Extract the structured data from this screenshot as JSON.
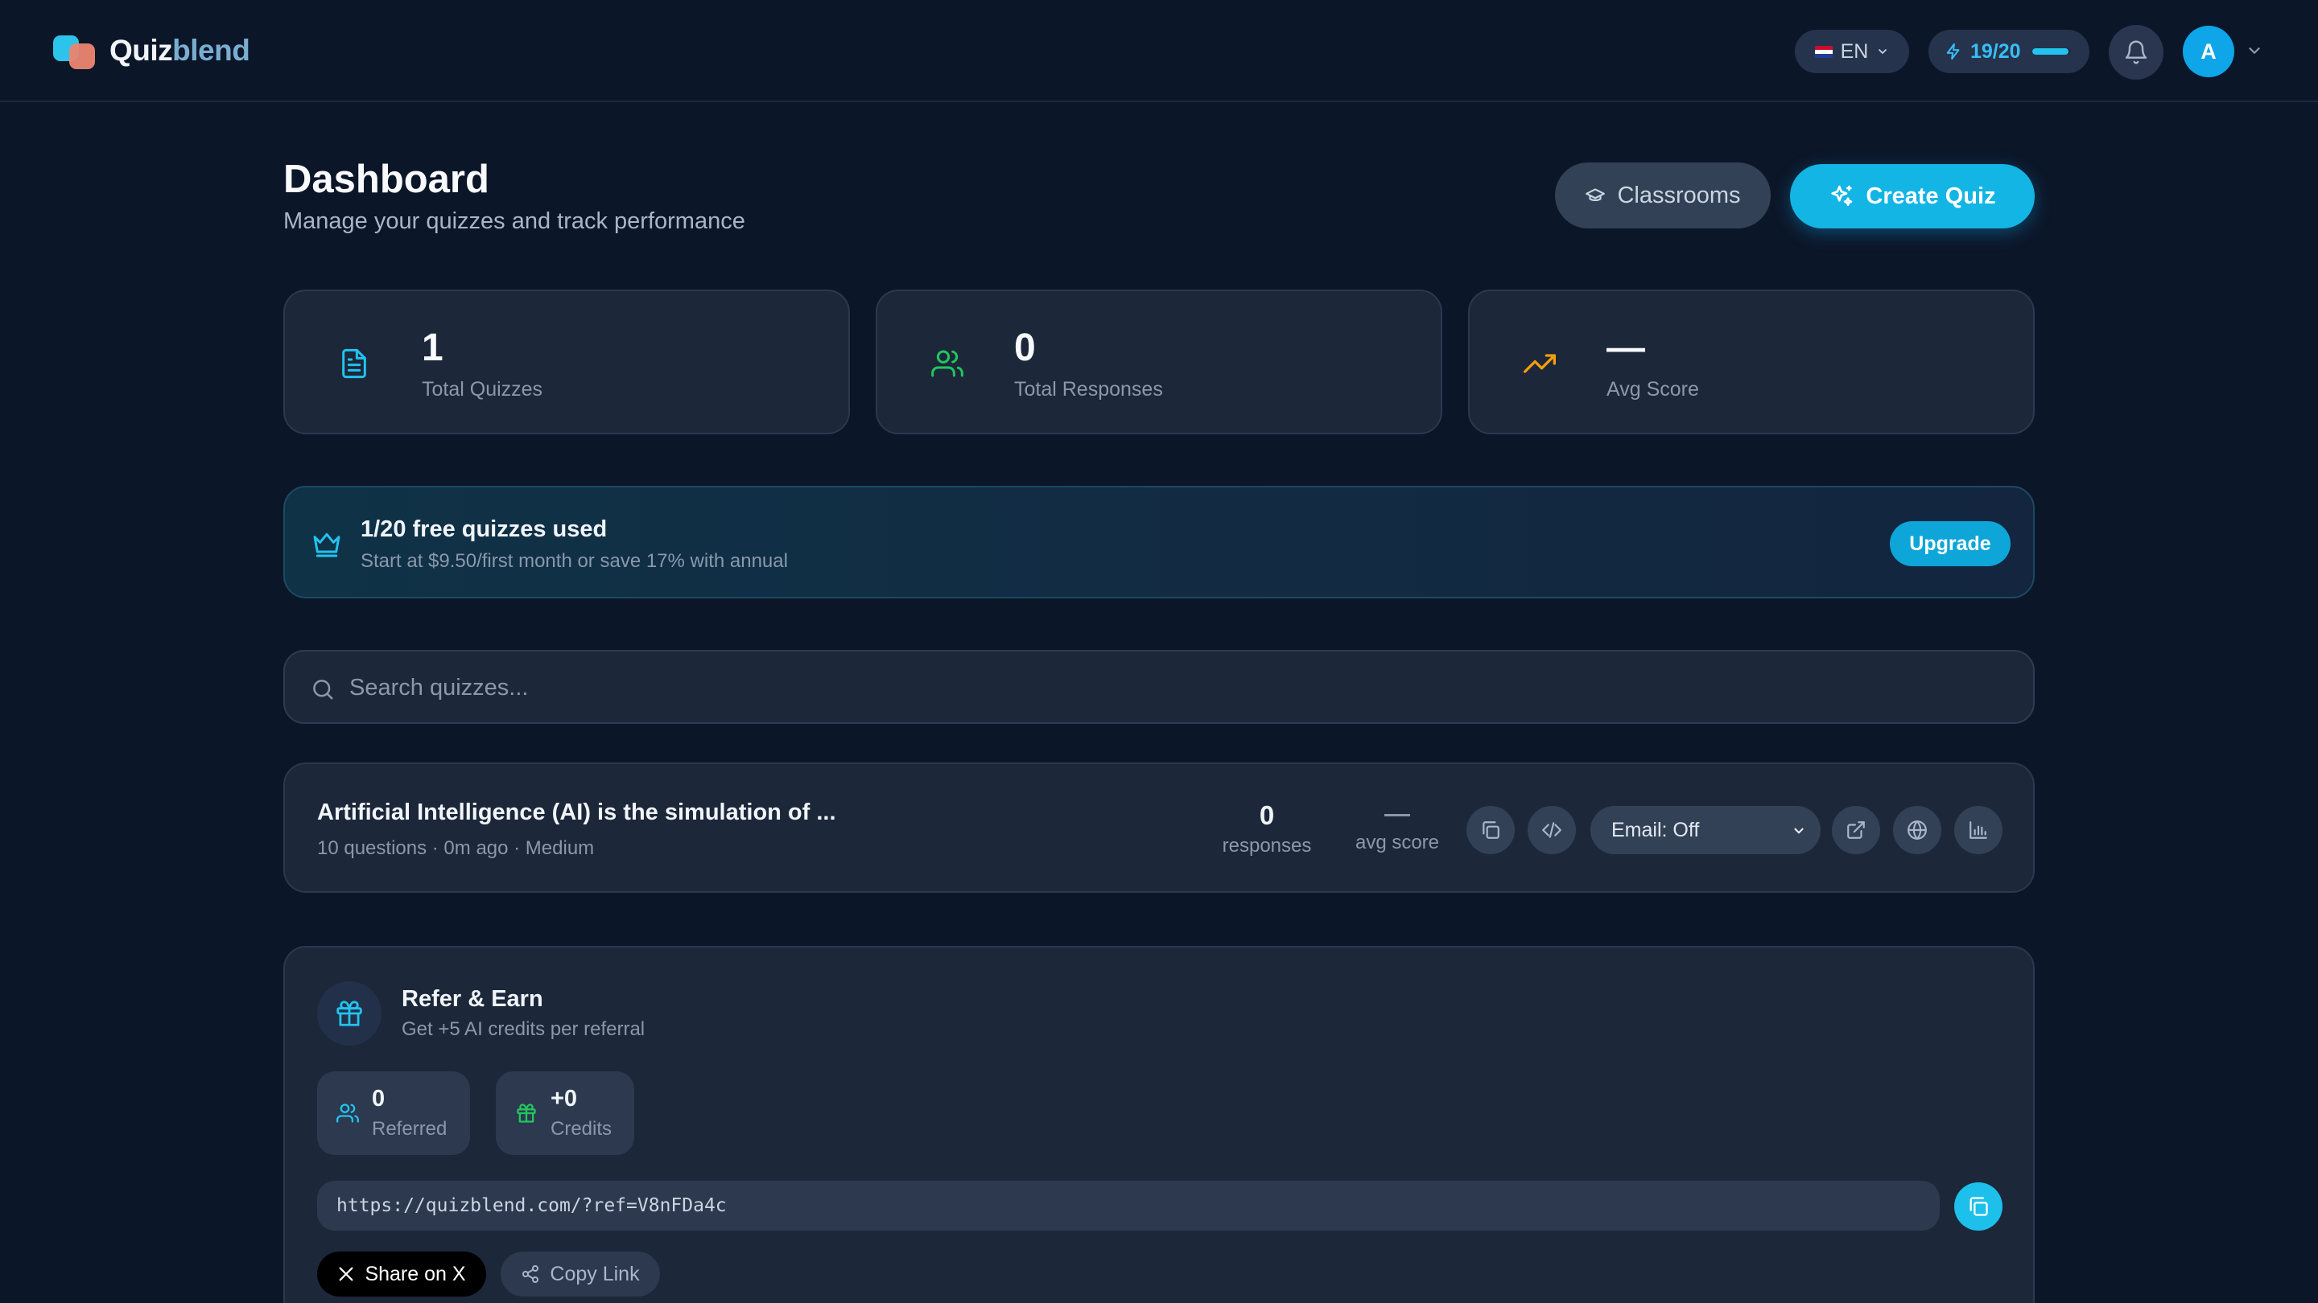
{
  "app": {
    "brand_part1": "Quiz",
    "brand_part2": "blend"
  },
  "topbar": {
    "language": "EN",
    "credits_label": "19/20",
    "credits_used": 19,
    "credits_total": 20,
    "avatar_initial": "A"
  },
  "header": {
    "title": "Dashboard",
    "subtitle": "Manage your quizzes and track performance",
    "classrooms_label": "Classrooms",
    "create_label": "Create Quiz"
  },
  "stats": [
    {
      "value": "1",
      "label": "Total Quizzes",
      "icon": "document-icon",
      "color": "#22c3ee"
    },
    {
      "value": "0",
      "label": "Total Responses",
      "icon": "users-icon",
      "color": "#22c55e"
    },
    {
      "value": "—",
      "label": "Avg Score",
      "icon": "trending-up-icon",
      "color": "#f59e0b"
    }
  ],
  "banner": {
    "title": "1/20 free quizzes used",
    "subtitle": "Start at $9.50/first month or save 17% with annual",
    "upgrade_label": "Upgrade"
  },
  "search": {
    "placeholder": "Search quizzes..."
  },
  "quizzes": [
    {
      "title": "Artificial Intelligence (AI) is the simulation of ...",
      "meta": "10 questions · 0m ago · Medium",
      "responses_value": "0",
      "responses_label": "responses",
      "avg_score_value": "—",
      "avg_score_label": "avg score",
      "email_setting": "Email: Off"
    }
  ],
  "referral": {
    "title": "Refer & Earn",
    "subtitle": "Get +5 AI credits per referral",
    "referred_value": "0",
    "referred_label": "Referred",
    "credits_value": "+0",
    "credits_label": "Credits",
    "link": "https://quizblend.com/?ref=V8nFDa4c",
    "share_label": "Share on X",
    "copy_label": "Copy Link"
  },
  "colors": {
    "background": "#0c1629",
    "card": "#1c273a",
    "accent": "#12b5e4",
    "text_muted": "#8b98ab"
  }
}
